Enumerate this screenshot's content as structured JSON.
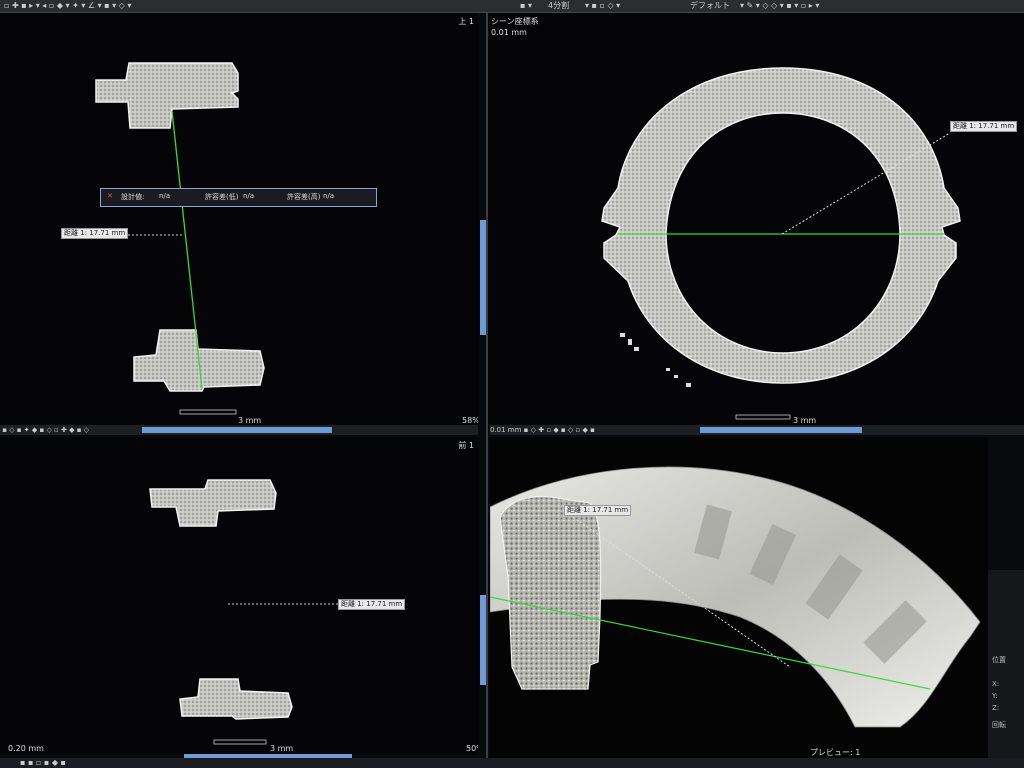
{
  "toolbar": {
    "layout_label": "4分割",
    "default_label": "デフォルト"
  },
  "views": {
    "top_left": {
      "label": "上 1",
      "zoom": "58%",
      "scale": "3 mm"
    },
    "top_right": {
      "label": "シーン座標系",
      "precision": "0.01 mm",
      "scale": "3 mm",
      "precision_footer": "0.01 mm"
    },
    "bottom_left": {
      "label": "前 1",
      "zoom": "50%",
      "scale": "3 mm",
      "precision_footer": "0.20 mm"
    },
    "bottom_right": {
      "footer_label": "プレビュー: 1"
    }
  },
  "measurement": {
    "label": "距離 1: 17.71 mm",
    "label_short": "距離 1: 17.71 mm"
  },
  "tolerance_hint": {
    "design_label": "設計値:",
    "design_value": "n/a",
    "lower_label": "許容差(低)",
    "lower_value": "n/a",
    "upper_label": "許容差(高)",
    "upper_value": "n/a"
  },
  "side_panel": {
    "items": [
      "位置",
      "X:",
      "Y:",
      "Z:",
      "回転"
    ]
  },
  "colors": {
    "scrollbar": "#6e9bd6",
    "measure_line": "#38d83a",
    "hint_border": "#8aa4d6"
  }
}
